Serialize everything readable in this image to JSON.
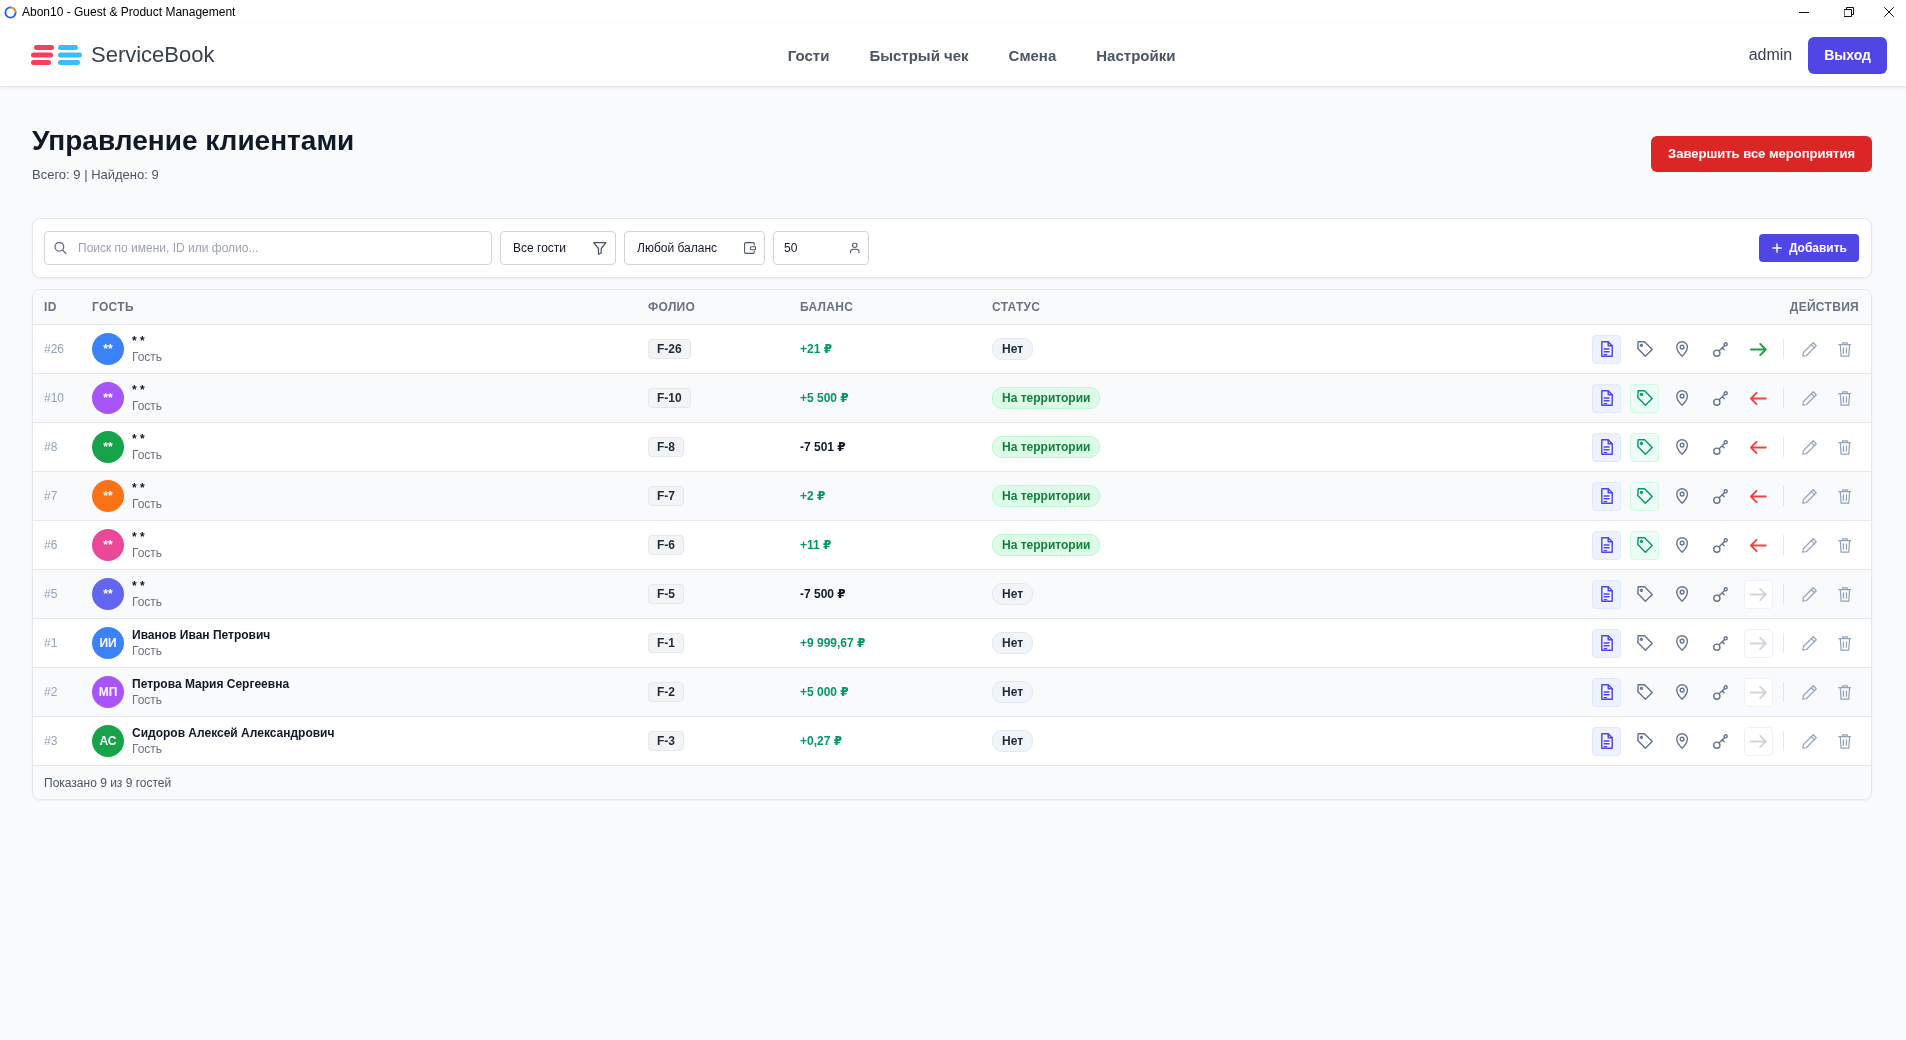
{
  "window": {
    "title": "Abon10 - Guest & Product Management"
  },
  "navbar": {
    "brand": "ServiceBook",
    "links": [
      "Гости",
      "Быстрый чек",
      "Смена",
      "Настройки"
    ],
    "user": "admin",
    "logout_button": "Выход"
  },
  "page": {
    "title": "Управление клиентами",
    "summary": "Всего: 9 | Найдено: 9",
    "finish_all_button": "Завершить все мероприятия"
  },
  "filters": {
    "search": {
      "placeholder": "Поиск по имени, ID или фолио..."
    },
    "guest_type": {
      "value": "Все гости"
    },
    "balance": {
      "value": "Любой баланс"
    },
    "limit": {
      "value": "50"
    },
    "add_button": "Добавить"
  },
  "table": {
    "columns": [
      "ID",
      "ГОСТЬ",
      "ФОЛИО",
      "БАЛАНС",
      "СТАТУС",
      "ДЕЙСТВИЯ"
    ],
    "rows": [
      {
        "id": "#26",
        "avatar": {
          "initials": "**",
          "color": "#3b82f6"
        },
        "name": "* *",
        "role": "Гость",
        "folio": "F-26",
        "balance": "+21 ₽",
        "debt": false,
        "status": {
          "label": "Нет",
          "kind": "absent"
        },
        "tag_active": false,
        "move": {
          "kind": "enter",
          "disabled": false
        }
      },
      {
        "id": "#10",
        "avatar": {
          "initials": "**",
          "color": "#a855f7"
        },
        "name": "* *",
        "role": "Гость",
        "folio": "F-10",
        "balance": "+5 500 ₽",
        "debt": false,
        "status": {
          "label": "На территории",
          "kind": "on_site"
        },
        "tag_active": true,
        "move": {
          "kind": "exit",
          "disabled": false
        }
      },
      {
        "id": "#8",
        "avatar": {
          "initials": "**",
          "color": "#16a34a"
        },
        "name": "* *",
        "role": "Гость",
        "folio": "F-8",
        "balance": "-7 501 ₽",
        "debt": true,
        "status": {
          "label": "На территории",
          "kind": "on_site"
        },
        "tag_active": true,
        "move": {
          "kind": "exit",
          "disabled": false
        }
      },
      {
        "id": "#7",
        "avatar": {
          "initials": "**",
          "color": "#f97316"
        },
        "name": "* *",
        "role": "Гость",
        "folio": "F-7",
        "balance": "+2 ₽",
        "debt": false,
        "status": {
          "label": "На территории",
          "kind": "on_site"
        },
        "tag_active": true,
        "move": {
          "kind": "exit",
          "disabled": false
        }
      },
      {
        "id": "#6",
        "avatar": {
          "initials": "**",
          "color": "#ec4899"
        },
        "name": "* *",
        "role": "Гость",
        "folio": "F-6",
        "balance": "+11 ₽",
        "debt": false,
        "status": {
          "label": "На территории",
          "kind": "on_site"
        },
        "tag_active": true,
        "move": {
          "kind": "exit",
          "disabled": false
        }
      },
      {
        "id": "#5",
        "avatar": {
          "initials": "**",
          "color": "#6366f1"
        },
        "name": "* *",
        "role": "Гость",
        "folio": "F-5",
        "balance": "-7 500 ₽",
        "debt": true,
        "status": {
          "label": "Нет",
          "kind": "absent"
        },
        "tag_active": false,
        "move": {
          "kind": "enter",
          "disabled": true
        }
      },
      {
        "id": "#1",
        "avatar": {
          "initials": "ИИ",
          "color": "#3b82f6"
        },
        "name": "Иванов Иван Петрович",
        "role": "Гость",
        "folio": "F-1",
        "balance": "+9 999,67 ₽",
        "debt": false,
        "status": {
          "label": "Нет",
          "kind": "absent"
        },
        "tag_active": false,
        "move": {
          "kind": "enter",
          "disabled": true
        }
      },
      {
        "id": "#2",
        "avatar": {
          "initials": "МП",
          "color": "#a855f7"
        },
        "name": "Петрова Мария Сергеевна",
        "role": "Гость",
        "folio": "F-2",
        "balance": "+5 000 ₽",
        "debt": false,
        "status": {
          "label": "Нет",
          "kind": "absent"
        },
        "tag_active": false,
        "move": {
          "kind": "enter",
          "disabled": true
        }
      },
      {
        "id": "#3",
        "avatar": {
          "initials": "АС",
          "color": "#16a34a"
        },
        "name": "Сидоров Алексей Александрович",
        "role": "Гость",
        "folio": "F-3",
        "balance": "+0,27 ₽",
        "debt": false,
        "status": {
          "label": "Нет",
          "kind": "absent"
        },
        "tag_active": false,
        "move": {
          "kind": "enter",
          "disabled": true
        }
      }
    ],
    "footer": "Показано 9 из 9 гостей"
  }
}
